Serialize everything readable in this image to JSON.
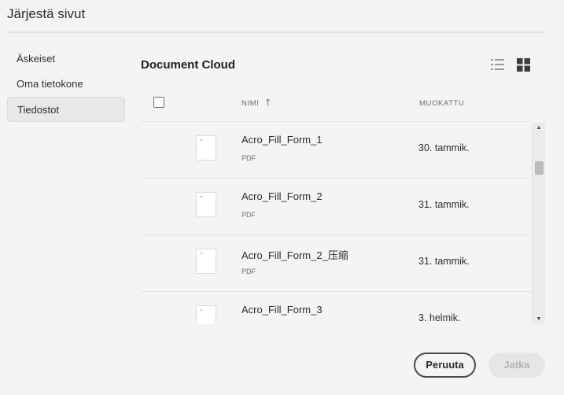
{
  "dialog": {
    "title": "Järjestä sivut"
  },
  "sidebar": {
    "items": [
      {
        "label": "Äskeiset",
        "active": false
      },
      {
        "label": "Oma tietokone",
        "active": false
      },
      {
        "label": "Tiedostot",
        "active": true
      }
    ]
  },
  "main": {
    "section_title": "Document Cloud",
    "view_modes": [
      "list-view-icon",
      "grid-view-icon"
    ],
    "columns": {
      "name": "NIMI",
      "modified": "MUOKATTU",
      "sort": "ascending"
    },
    "files": [
      {
        "name": "Acro_Fill_Form_1",
        "type": "PDF",
        "modified": "30. tammik."
      },
      {
        "name": "Acro_Fill_Form_2",
        "type": "PDF",
        "modified": "31. tammik."
      },
      {
        "name": "Acro_Fill_Form_2_压缩",
        "type": "PDF",
        "modified": "31. tammik."
      },
      {
        "name": "Acro_Fill_Form_3",
        "type": "",
        "modified": "3. helmik."
      }
    ]
  },
  "footer": {
    "cancel_label": "Peruuta",
    "continue_label": "Jatka"
  },
  "colors": {
    "accent": "#2c2c2c",
    "disabled": "#b3b3b3",
    "background": "#f4f4f4"
  }
}
